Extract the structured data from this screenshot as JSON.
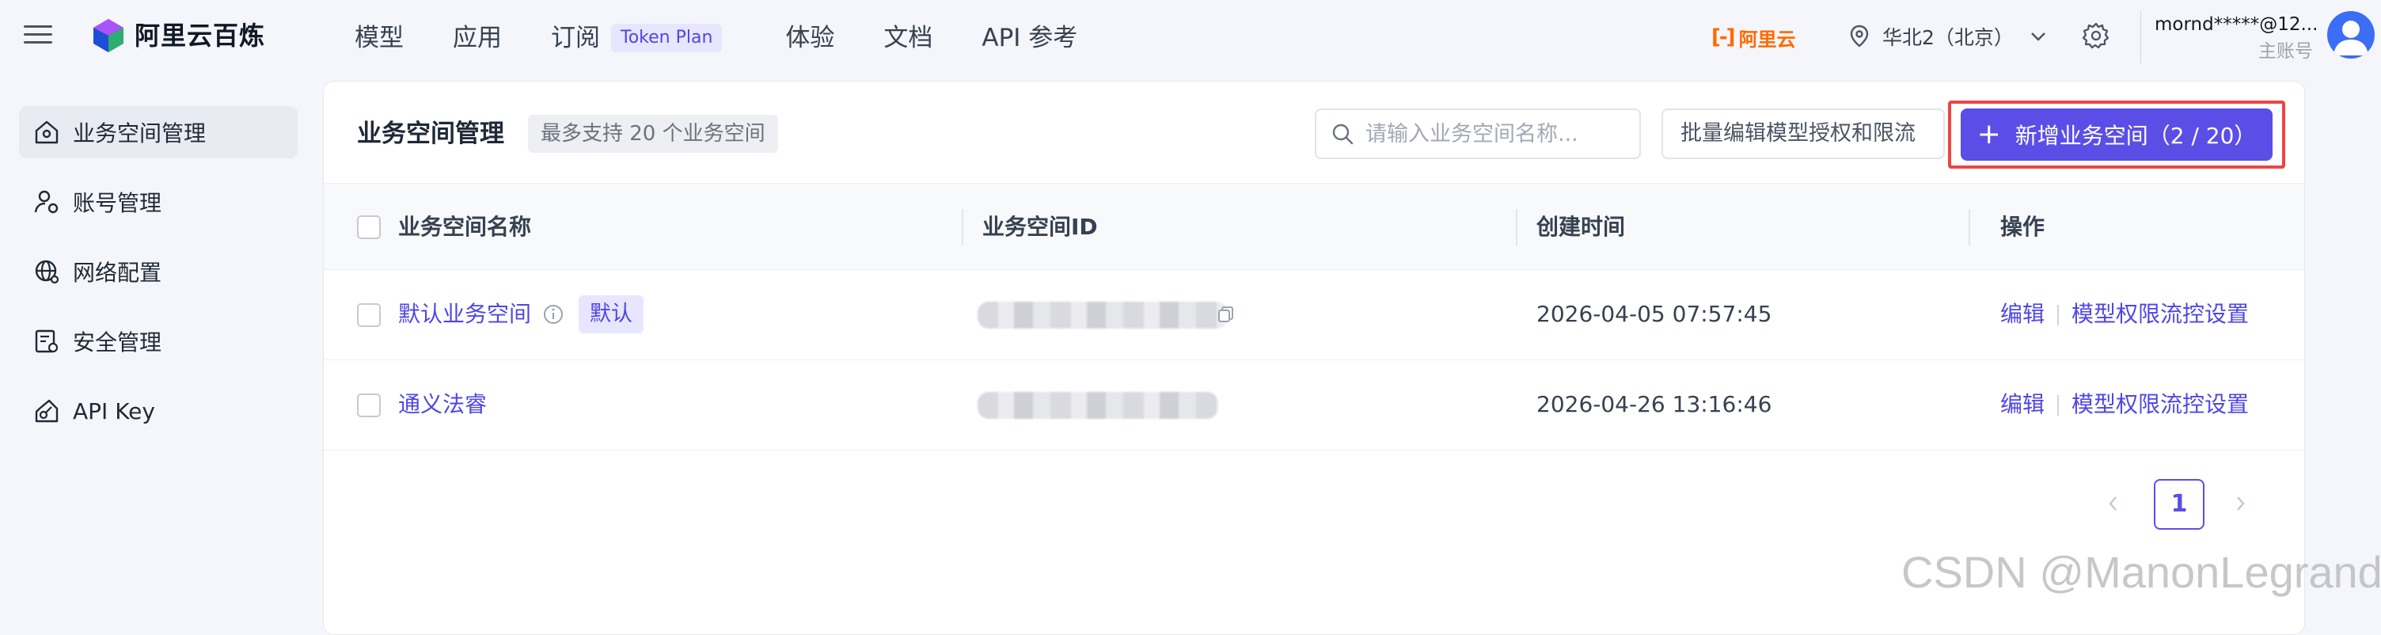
{
  "topbar": {
    "brand": "阿里云百炼",
    "nav": [
      {
        "label": "模型"
      },
      {
        "label": "应用"
      },
      {
        "label": "订阅",
        "badge": "Token Plan"
      },
      {
        "label": "体验"
      },
      {
        "label": "文档"
      },
      {
        "label": "API 参考"
      }
    ],
    "aliyun_logo": "阿里云",
    "region": "华北2（北京）",
    "account_name": "mornd*****@12...",
    "account_role": "主账号"
  },
  "sidebar": {
    "items": [
      {
        "label": "业务空间管理",
        "icon": "home-icon",
        "active": true
      },
      {
        "label": "账号管理",
        "icon": "user-settings-icon",
        "active": false
      },
      {
        "label": "网络配置",
        "icon": "globe-network-icon",
        "active": false
      },
      {
        "label": "安全管理",
        "icon": "security-document-icon",
        "active": false
      },
      {
        "label": "API Key",
        "icon": "key-icon",
        "active": false
      }
    ]
  },
  "main": {
    "title": "业务空间管理",
    "hint": "最多支持 20 个业务空间",
    "search_placeholder": "请输入业务空间名称...",
    "batch_button": "批量编辑模型授权和限流",
    "add_button": "新增业务空间（2 / 20）",
    "table": {
      "columns": [
        "业务空间名称",
        "业务空间ID",
        "创建时间",
        "操作"
      ],
      "rows": [
        {
          "name": "默认业务空间",
          "tag": "默认",
          "created": "2026-04-05 07:57:45",
          "action_edit": "编辑",
          "action_model": "模型权限流控设置"
        },
        {
          "name": "通义法睿",
          "tag": "",
          "created": "2026-04-26 13:16:46",
          "action_edit": "编辑",
          "action_model": "模型权限流控设置"
        }
      ]
    },
    "pagination": {
      "current_page": "1"
    }
  },
  "watermark": "CSDN @ManonLegrand",
  "colors": {
    "accent": "#5b4ee6",
    "link": "#4f46e5",
    "aliyun_orange": "#ff6a00",
    "highlight_red": "#ef4444"
  }
}
